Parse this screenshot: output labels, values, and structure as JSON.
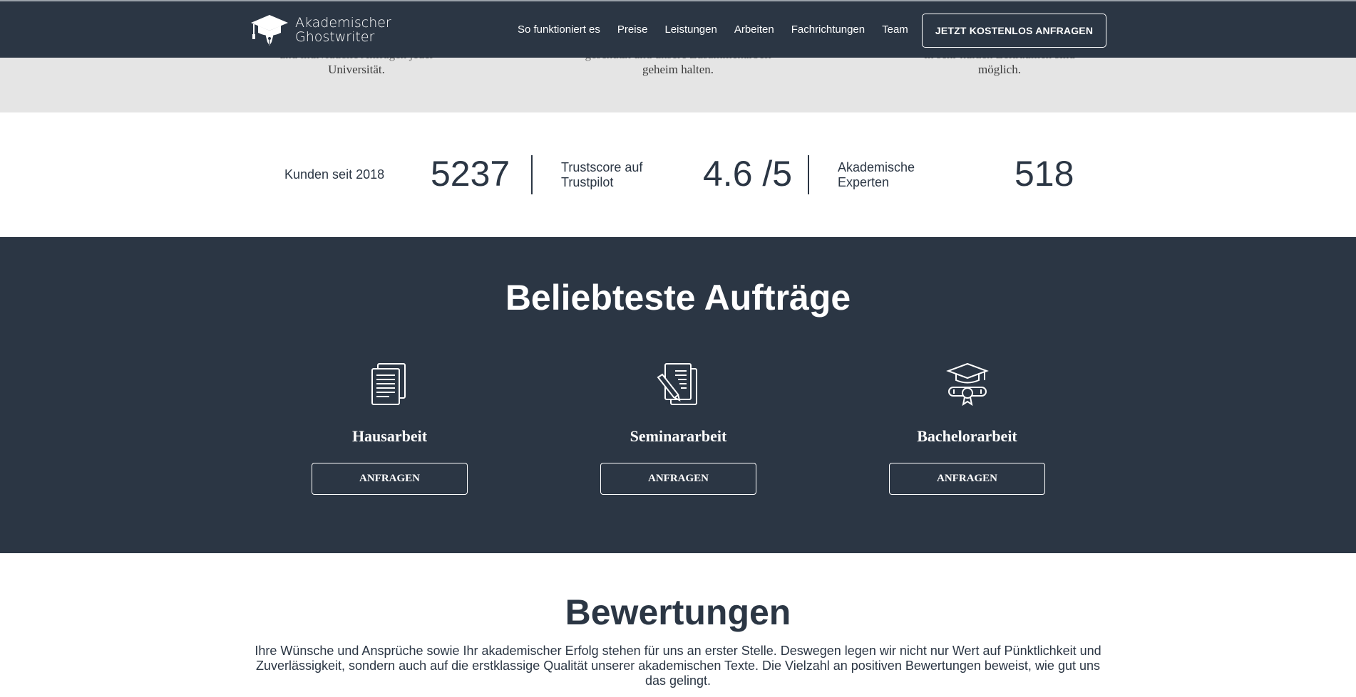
{
  "header": {
    "logo_line1": "Akademischer",
    "logo_line2": "Ghostwriter",
    "nav": [
      "So funktioniert es",
      "Preise",
      "Leistungen",
      "Arbeiten",
      "Fachrichtungen",
      "Team"
    ],
    "cta_label": "JETZT KOSTENLOS ANFRAGEN"
  },
  "features": [
    {
      "partial_line": "und individuelle Anfragen jeder",
      "last_line": "Universität."
    },
    {
      "partial_line": "geschützt und unsere Zusammenarbeit",
      "last_line": "geheim halten."
    },
    {
      "partial_line": "in sehr kurzen Zeiträumen sind",
      "last_line": "möglich."
    }
  ],
  "stats": [
    {
      "label": "Kunden seit 2018",
      "value": "5237"
    },
    {
      "label_line1": "Trustscore auf",
      "label_line2": "Trustpilot",
      "value": "4.6 /5"
    },
    {
      "label_line1": "Akademische",
      "label_line2": "Experten",
      "value": "518"
    }
  ],
  "orders": {
    "title": "Beliebteste Aufträge",
    "items": [
      {
        "name": "Hausarbeit",
        "button": "ANFRAGEN",
        "icon": "documents-icon"
      },
      {
        "name": "Seminararbeit",
        "button": "ANFRAGEN",
        "icon": "document-pen-icon"
      },
      {
        "name": "Bachelorarbeit",
        "button": "ANFRAGEN",
        "icon": "graduation-diploma-icon"
      }
    ]
  },
  "reviews": {
    "title": "Bewertungen",
    "text": "Ihre Wünsche und Ansprüche sowie Ihr akademischer Erfolg stehen für uns an erster Stelle. Deswegen legen wir nicht nur Wert auf Pünktlichkeit und Zuverlässigkeit, sondern auch auf die erstklassige Qualität unserer akademischen Texte. Die Vielzahl an positiven Bewertungen beweist, wie gut uns das gelingt."
  },
  "colors": {
    "navy": "#2b3644",
    "grey_band": "#e5e5e5",
    "white": "#ffffff"
  }
}
